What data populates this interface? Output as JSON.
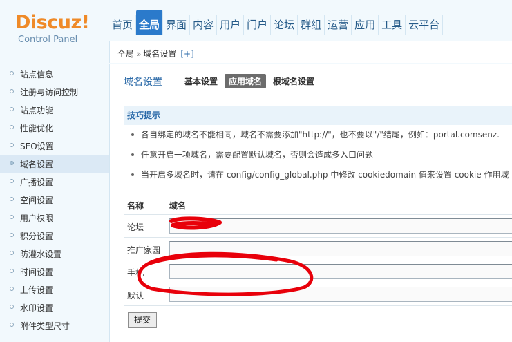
{
  "brand": {
    "logo_text": "Discuz!",
    "logo_sub": "Control Panel"
  },
  "topnav": {
    "tabs": [
      "首页",
      "全局",
      "界面",
      "内容",
      "用户",
      "门户",
      "论坛",
      "群组",
      "运营",
      "应用",
      "工具",
      "云平台"
    ],
    "active_index": 1
  },
  "breadcrumb": {
    "section": "全局",
    "separator": "»",
    "current": "域名设置",
    "add": "[+]"
  },
  "sidebar": {
    "items": [
      "站点信息",
      "注册与访问控制",
      "站点功能",
      "性能优化",
      "SEO设置",
      "域名设置",
      "广播设置",
      "空间设置",
      "用户权限",
      "积分设置",
      "防灌水设置",
      "时间设置",
      "上传设置",
      "水印设置",
      "附件类型尺寸"
    ],
    "active_index": 5
  },
  "main": {
    "page_title": "域名设置",
    "sub_tabs": [
      "基本设置",
      "应用域名",
      "根域名设置"
    ],
    "active_sub_tab": 1
  },
  "tips": {
    "heading": "技巧提示",
    "items": [
      "各自绑定的域名不能相同，域名不需要添加\"http://\"，也不要以\"/\"结尾，例如：portal.comsenz.",
      "任意开启一项域名，需要配置默认域名，否则会造成多入口问题",
      "当开启多域名时，请在 config/config_global.php 中修改 cookiedomain 值来设置 cookie 作用域"
    ]
  },
  "domain_table": {
    "headers": {
      "name": "名称",
      "domain": "域名"
    },
    "rows": [
      {
        "label": "论坛",
        "value": ""
      },
      {
        "label": "推广家园",
        "value": ""
      },
      {
        "label": "手机",
        "value": ""
      },
      {
        "label": "默认",
        "value": ""
      }
    ],
    "submit_label": "提交"
  },
  "colors": {
    "accent": "#2b7acb",
    "header_bg": "#f2f9fd",
    "logo_orange": "#ef8a28",
    "scribble": "#e8000a"
  }
}
